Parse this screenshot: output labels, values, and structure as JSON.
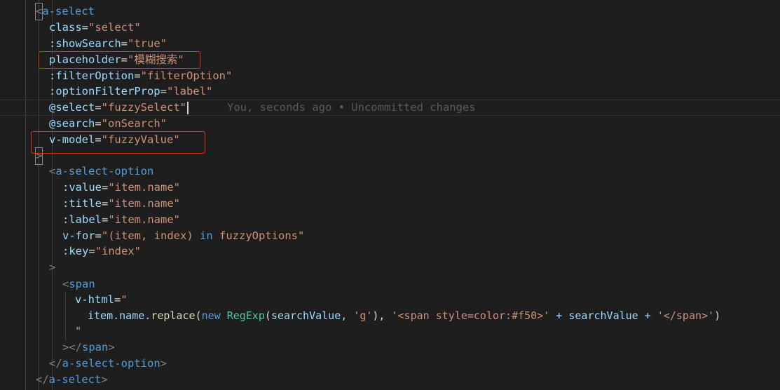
{
  "editor": {
    "blame_annotation": "You, seconds ago • Uncommitted changes",
    "highlight_color": "#e0301e",
    "code": {
      "select_open": "a-select",
      "attr_class": "class",
      "val_class": "\"select\"",
      "attr_showsearch": ":showSearch",
      "val_showsearch": "\"true\"",
      "attr_placeholder": "placeholder",
      "val_placeholder": "\"模糊搜索\"",
      "attr_filteroption": ":filterOption",
      "val_filteroption": "\"filterOption\"",
      "attr_optionfilterprop": ":optionFilterProp",
      "val_optionfilterprop": "\"label\"",
      "attr_select": "@select",
      "val_select": "\"fuzzySelect\"",
      "attr_search": "@search",
      "val_search": "\"onSearch\"",
      "attr_vmodel": "v-model",
      "val_vmodel": "\"fuzzyValue\"",
      "option_open": "a-select-option",
      "attr_value": ":value",
      "val_value": "\"item.name\"",
      "attr_title": ":title",
      "val_title": "\"item.name\"",
      "attr_label": ":label",
      "val_label": "\"item.name\"",
      "attr_vfor": "v-for",
      "val_vfor_open": "\"(item, index) ",
      "kw_in": "in",
      "val_vfor_close": " fuzzyOptions\"",
      "attr_key": ":key",
      "val_key": "\"index\"",
      "span_tag": "span",
      "attr_vhtml": "v-html",
      "val_vhtml_open": "\"",
      "expr_item_name": "item.name.",
      "expr_replace": "replace",
      "expr_new": "new",
      "expr_regexp": "RegExp",
      "expr_args": "searchValue, ",
      "expr_g": "'g'",
      "expr_span_open": "'<span style=color:#f50>'",
      "expr_plus_search": " + searchValue + ",
      "expr_span_close": "'</span>'",
      "val_vhtml_close": "\"",
      "option_close": "a-select-option",
      "select_close": "a-select"
    }
  }
}
